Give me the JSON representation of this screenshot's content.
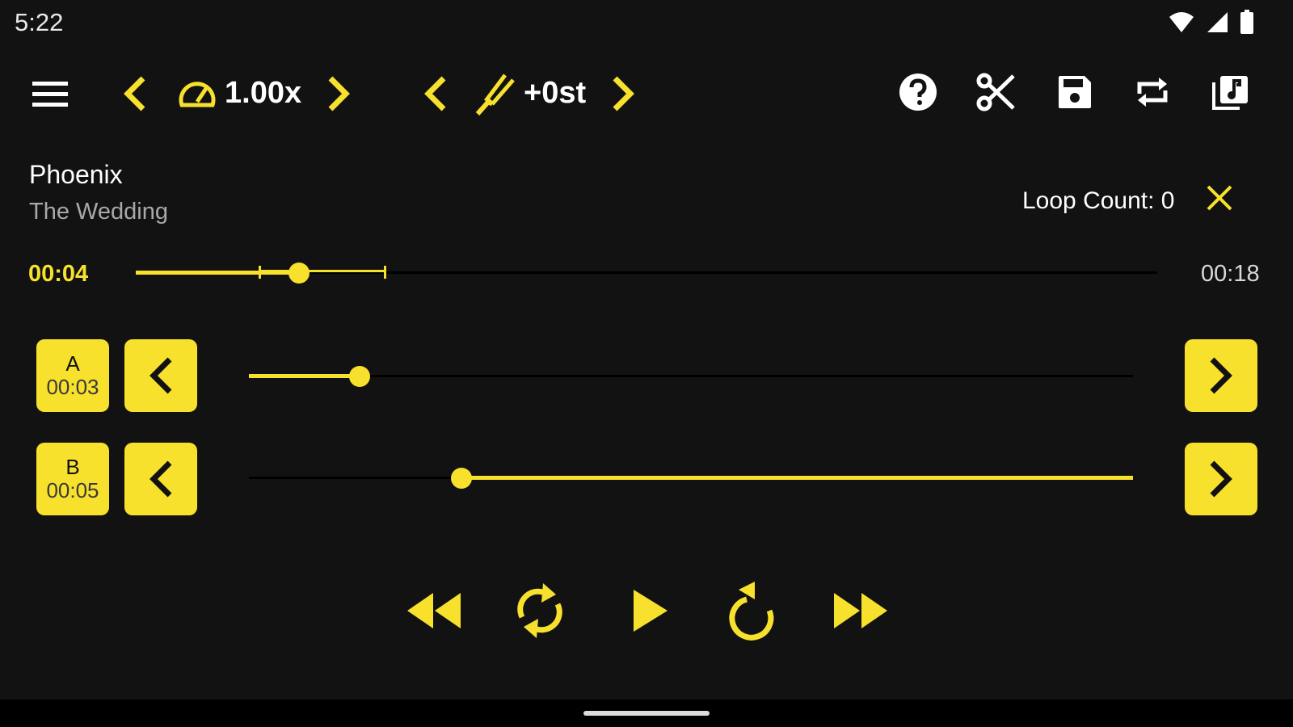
{
  "status_bar": {
    "time": "5:22",
    "icons": [
      "wifi-icon",
      "signal-icon",
      "battery-icon"
    ]
  },
  "toolbar": {
    "speed_value": "1.00x",
    "pitch_value": "+0st",
    "icons": [
      "menu-icon",
      "chevron-left-icon",
      "speedometer-icon",
      "chevron-right-icon",
      "tuning-fork-icon",
      "help-icon",
      "scissors-icon",
      "save-icon",
      "repeat-icon",
      "music-library-icon"
    ]
  },
  "track": {
    "title": "Phoenix",
    "artist": "The Wedding"
  },
  "loop": {
    "count_label": "Loop Count: 0"
  },
  "seek": {
    "position": "00:04",
    "duration": "00:18",
    "progress_fraction": 0.16,
    "loop_start_fraction": 0.12,
    "loop_end_fraction": 0.245
  },
  "markers": {
    "a": {
      "letter": "A",
      "time": "00:03",
      "slider_fraction": 0.125
    },
    "b": {
      "letter": "B",
      "time": "00:05",
      "slider_fraction": 0.24
    }
  },
  "transport": {
    "icons": [
      "rewind-icon",
      "loop-icon",
      "play-icon",
      "replay-icon",
      "fast-forward-icon"
    ]
  },
  "colors": {
    "accent": "#f7e12c",
    "background": "#121212",
    "text_primary": "#ffffff",
    "text_secondary": "#a8a8a8"
  }
}
